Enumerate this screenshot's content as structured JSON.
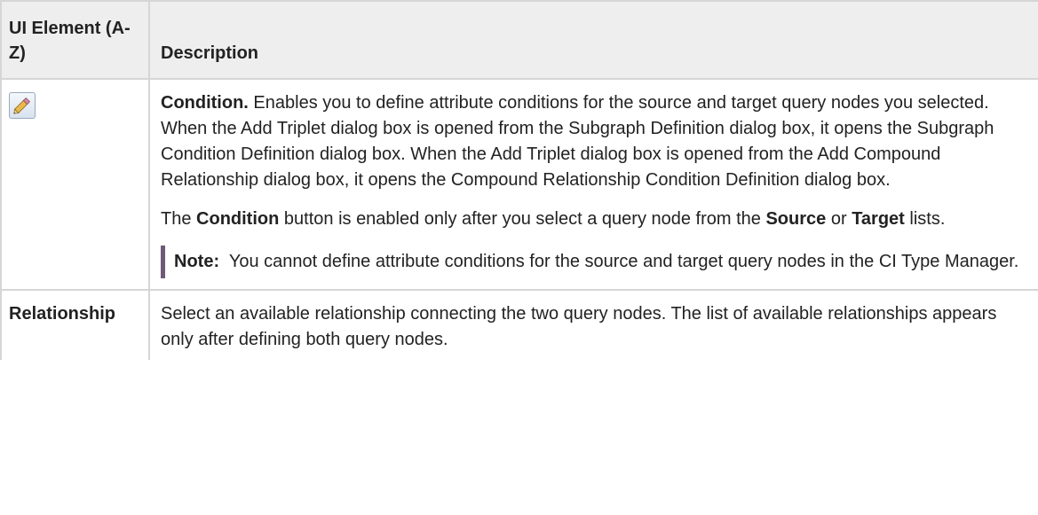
{
  "table": {
    "headers": [
      "UI Element (A-Z)",
      "Description"
    ],
    "rows": [
      {
        "element_icon": "pencil-icon",
        "description": {
          "p1_bold": "Condition.",
          "p1_text": " Enables you to define attribute conditions for the source and target query nodes you selected. When the Add Triplet dialog box is opened from the Subgraph Definition dialog box, it opens the Subgraph Condition Definition dialog box. When the Add Triplet dialog box is opened from the Add Compound Relationship dialog box, it opens the Compound Relationship Condition Definition dialog box.",
          "p2_t1": "The ",
          "p2_b1": "Condition",
          "p2_t2": " button is enabled only after you select a query node from the ",
          "p2_b2": "Source",
          "p2_t3": " or ",
          "p2_b3": "Target",
          "p2_t4": " lists.",
          "note_label": "Note:",
          "note_text": "  You cannot define attribute conditions for the source and target query nodes in the CI Type Manager."
        }
      },
      {
        "element": "Relationship",
        "description": "Select an available relationship connecting the two query nodes. The list of available relationships appears only after defining both query nodes."
      }
    ]
  }
}
